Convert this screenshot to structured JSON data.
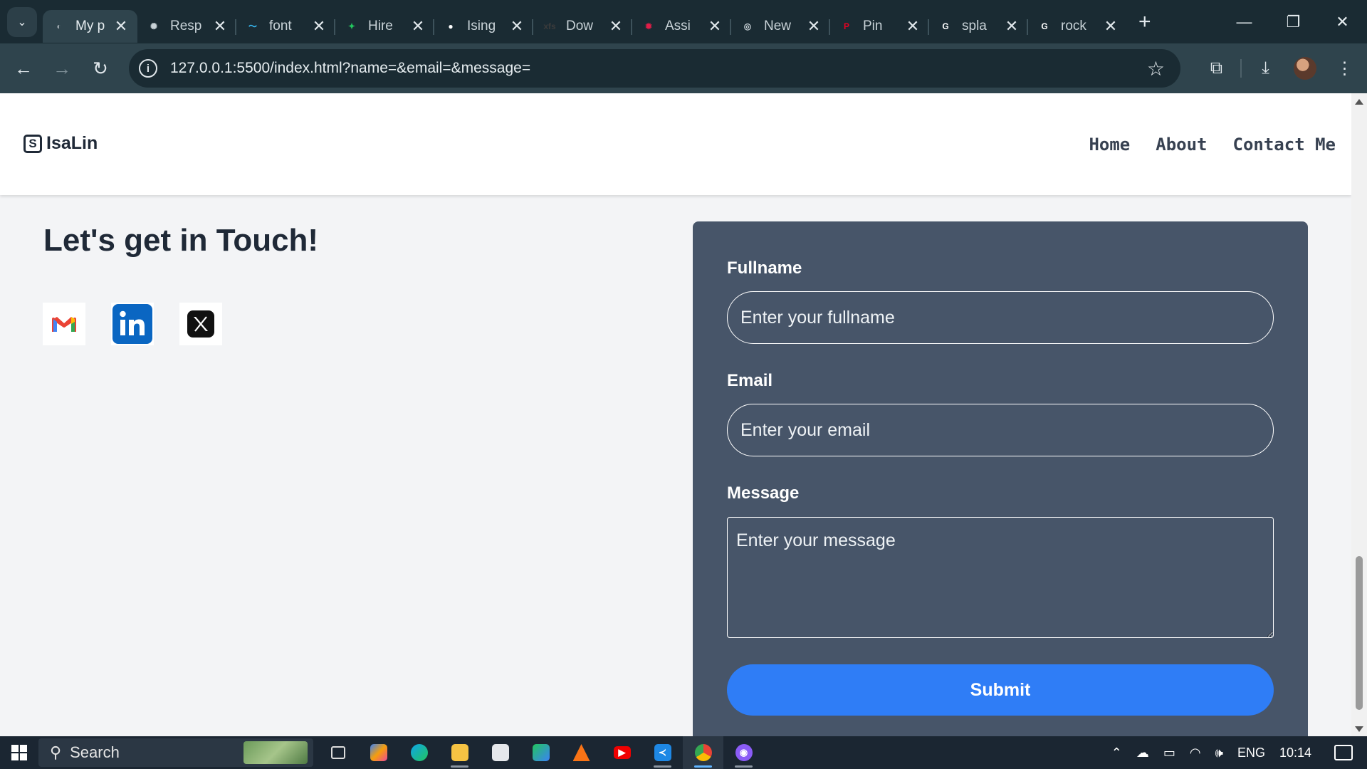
{
  "browser": {
    "tabs": [
      {
        "label": "My p",
        "active": true,
        "fav_color": "#9aa5ab"
      },
      {
        "label": "Resp",
        "fav_color": "#c9d3d8"
      },
      {
        "label": "font",
        "fav_color": "#38bdf8"
      },
      {
        "label": "Hire",
        "fav_color": "#22c55e"
      },
      {
        "label": "Ising",
        "fav_color": "#ffffff"
      },
      {
        "label": "Dow",
        "fav_color": "#3b3b3b"
      },
      {
        "label": "Assi",
        "fav_color": "#e11d48"
      },
      {
        "label": "New",
        "fav_color": "#c9d3d8"
      },
      {
        "label": "Pin",
        "fav_color": "#e60023"
      },
      {
        "label": "spla",
        "fav_color": "#ffffff"
      },
      {
        "label": "rock",
        "fav_color": "#ffffff"
      }
    ],
    "fav_glyphs": [
      "◐",
      "✺",
      "〜",
      "✦",
      "●",
      "xfs",
      "✹",
      "◎",
      "P",
      "G",
      "G"
    ],
    "url": "127.0.0.1:5500/index.html?name=&email=&message="
  },
  "site": {
    "logo_text": "IsaLin",
    "logo_mark": "S",
    "nav": [
      "Home",
      "About",
      "Contact Me"
    ],
    "headline": "Let's get in Touch!",
    "socials": [
      "gmail-icon",
      "linkedin-icon",
      "x-icon"
    ],
    "form": {
      "fullname_label": "Fullname",
      "fullname_placeholder": "Enter your fullname",
      "email_label": "Email",
      "email_placeholder": "Enter your email",
      "message_label": "Message",
      "message_placeholder": "Enter your message",
      "submit_label": "Submit"
    },
    "colors": {
      "card": "#475569",
      "submit": "#2f7df6"
    }
  },
  "taskbar": {
    "search_label": "Search",
    "language": "ENG",
    "time": "10:14"
  }
}
